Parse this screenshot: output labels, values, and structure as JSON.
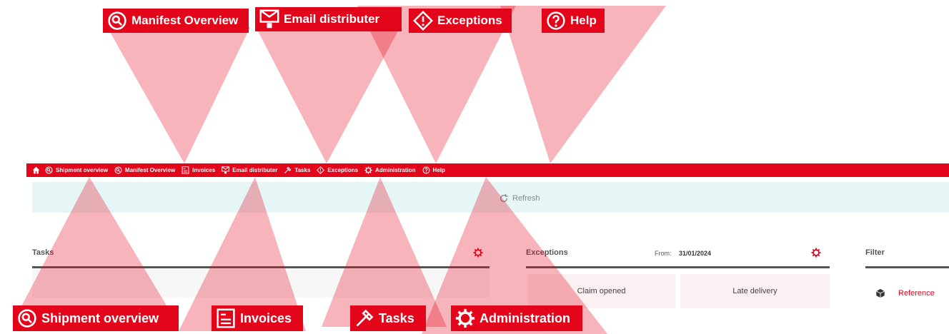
{
  "nav": {
    "home_icon": "home-icon",
    "items": [
      {
        "label": "Shipment overview",
        "icon": "magnifier-icon"
      },
      {
        "label": "Manifest Overview",
        "icon": "magnifier-icon"
      },
      {
        "label": "Invoices",
        "icon": "invoice-icon"
      },
      {
        "label": "Email distributer",
        "icon": "envelope-icon"
      },
      {
        "label": "Tasks",
        "icon": "hammer-icon"
      },
      {
        "label": "Exceptions",
        "icon": "diamond-alert-icon"
      },
      {
        "label": "Administration",
        "icon": "gear-icon"
      },
      {
        "label": "Help",
        "icon": "question-icon"
      }
    ]
  },
  "callouts_top": [
    {
      "label": "Manifest Overview",
      "icon": "magnifier-icon"
    },
    {
      "label": "Email distributer",
      "icon": "envelope-icon"
    },
    {
      "label": "Exceptions",
      "icon": "diamond-alert-icon"
    },
    {
      "label": "Help",
      "icon": "question-icon"
    }
  ],
  "callouts_bottom": [
    {
      "label": "Shipment overview",
      "icon": "magnifier-icon"
    },
    {
      "label": "Invoices",
      "icon": "invoice-icon"
    },
    {
      "label": "Tasks",
      "icon": "hammer-icon"
    },
    {
      "label": "Administration",
      "icon": "gear-icon"
    }
  ],
  "toolbar": {
    "refresh_label": "Refresh"
  },
  "panels": {
    "tasks": {
      "title": "Tasks"
    },
    "exceptions": {
      "title": "Exceptions",
      "from_label": "From:",
      "from_value": "31/01/2024",
      "tiles": [
        "Claim opened",
        "Late delivery"
      ]
    },
    "filter": {
      "title": "Filter",
      "item_label": "Reference"
    }
  },
  "colors": {
    "brand": "#e3061b",
    "ray": "#e3061b"
  }
}
